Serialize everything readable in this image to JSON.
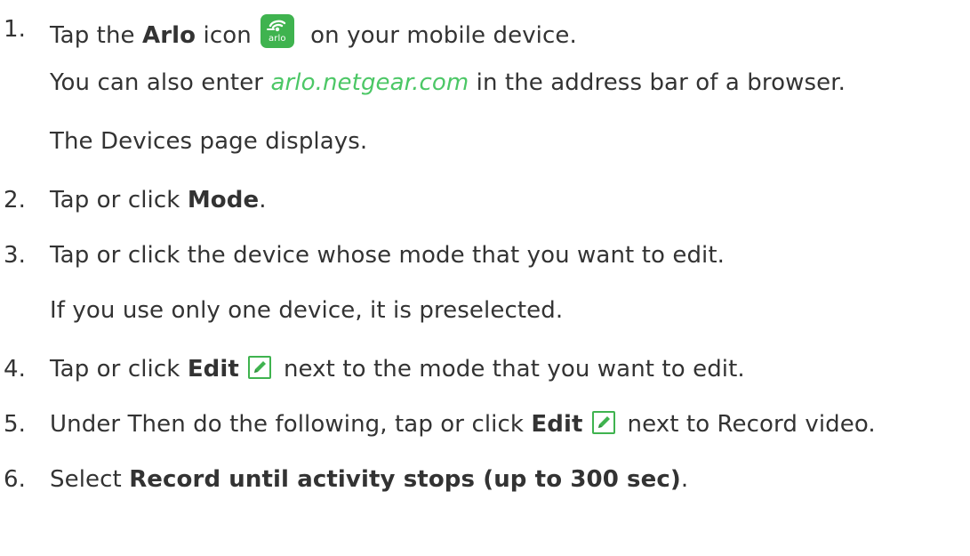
{
  "steps": [
    {
      "num": "1.",
      "pre": "Tap the ",
      "bold": "Arlo",
      "mid": " icon",
      "icon": "arlo-app-icon",
      "post": " on your mobile device.",
      "notes": [
        {
          "pre": "You can also enter ",
          "link": "arlo.netgear.com",
          "post": " in the address bar of a browser."
        },
        {
          "text": "The Devices page displays."
        }
      ]
    },
    {
      "num": "2.",
      "pre": "Tap or click ",
      "bold": "Mode",
      "post": "."
    },
    {
      "num": "3.",
      "text": "Tap or click the device whose mode that you want to edit.",
      "notes": [
        {
          "text": "If you use only one device, it is preselected."
        }
      ]
    },
    {
      "num": "4.",
      "pre": "Tap or click ",
      "bold": "Edit",
      "icon": "edit-pencil-icon",
      "post": "next to the mode that you want to edit."
    },
    {
      "num": "5.",
      "pre": "Under Then do the following, tap or click ",
      "bold": "Edit",
      "icon": "edit-pencil-icon",
      "post": "next to Record video."
    },
    {
      "num": "6.",
      "pre": "Select ",
      "bold": "Record until activity stops (up to 300 sec)",
      "post": "."
    }
  ],
  "arlo_icon": {
    "wordmark": "arlo",
    "color": "#3fb34f"
  },
  "link_color": "#4cc766"
}
